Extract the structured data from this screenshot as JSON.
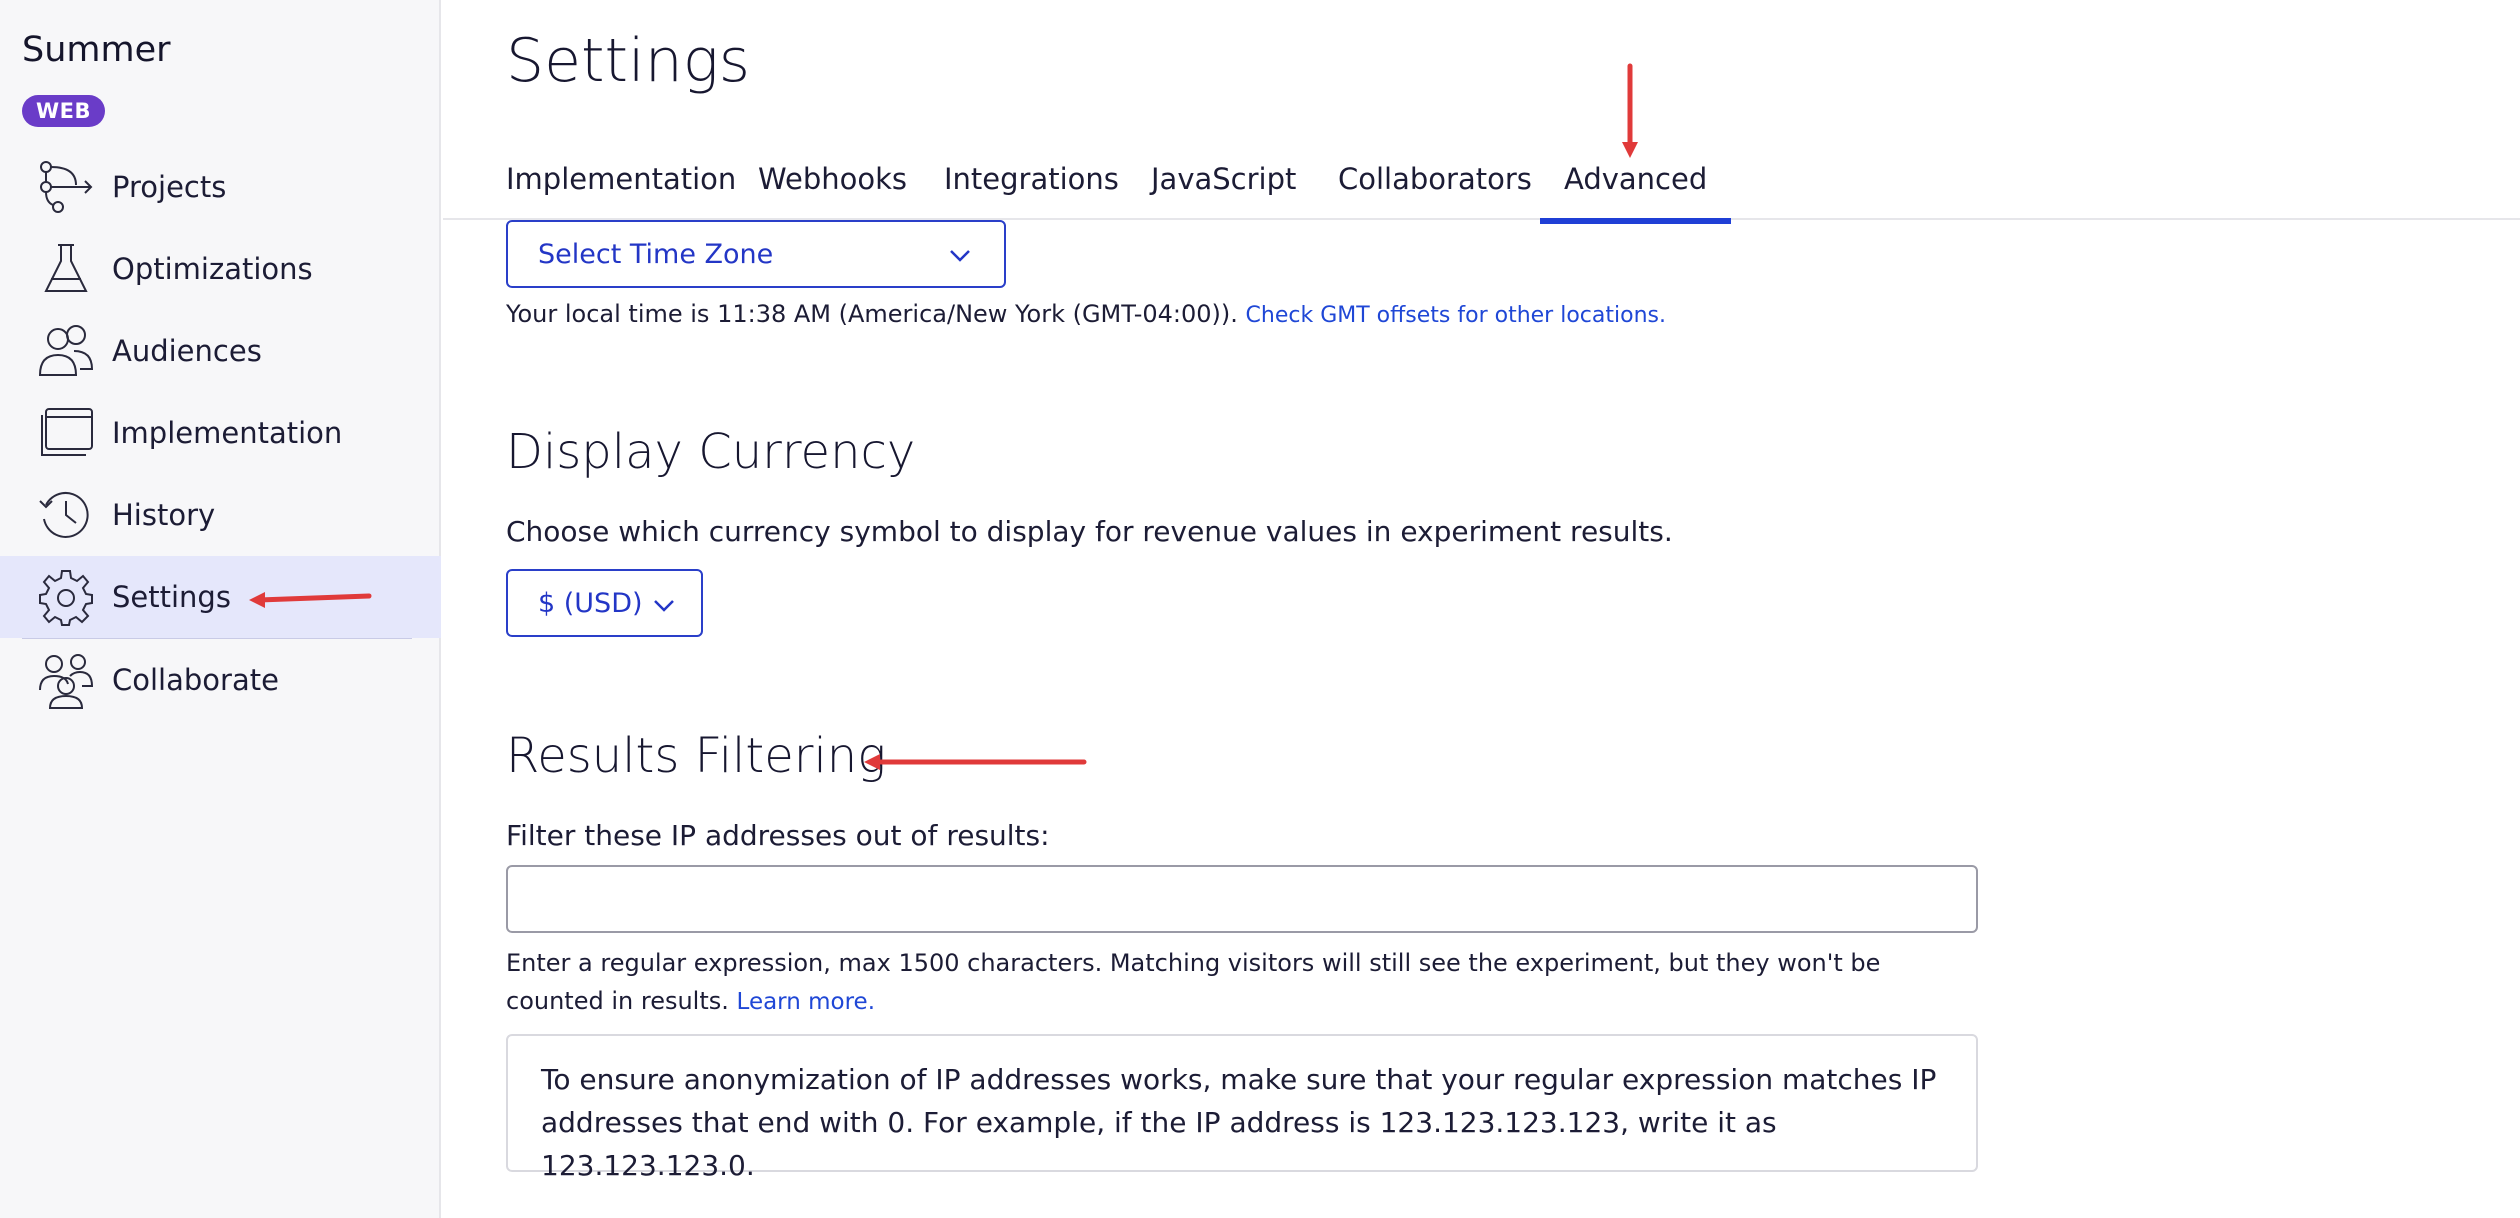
{
  "sidebar": {
    "brand": "Summer",
    "badge": "WEB",
    "items": [
      {
        "label": "Projects",
        "icon": "projects-icon"
      },
      {
        "label": "Optimizations",
        "icon": "flask-icon"
      },
      {
        "label": "Audiences",
        "icon": "audiences-icon"
      },
      {
        "label": "Implementation",
        "icon": "implementation-icon"
      },
      {
        "label": "History",
        "icon": "history-icon"
      },
      {
        "label": "Settings",
        "icon": "gear-icon",
        "active": true
      },
      {
        "label": "Collaborate",
        "icon": "collaborate-icon"
      }
    ]
  },
  "header": {
    "title": "Settings",
    "tabs": [
      "Implementation",
      "Webhooks",
      "Integrations",
      "JavaScript",
      "Collaborators",
      "Advanced"
    ],
    "active_tab": "Advanced"
  },
  "timezone": {
    "select_label": "Select Time Zone",
    "local_time_text": "Your local time is 11:38 AM (America/New York (GMT-04:00)).",
    "gmt_link": "Check GMT offsets for other locations."
  },
  "currency": {
    "heading": "Display Currency",
    "description": "Choose which currency symbol to display for revenue values in experiment results.",
    "selected": "$ (USD)"
  },
  "filtering": {
    "heading": "Results Filtering",
    "label": "Filter these IP addresses out of results:",
    "value": "",
    "help_text": "Enter a regular expression, max 1500 characters. Matching visitors will still see the experiment, but they won't be counted in results.",
    "learn_more": "Learn more.",
    "notice": "To ensure anonymization of IP addresses works, make sure that your regular expression matches IP addresses that end with 0. For example, if the IP address is 123.123.123.123, write it as 123.123.123.0."
  },
  "colors": {
    "accent": "#1f3fd6",
    "badge": "#6a3cc8",
    "annotation": "#e03a3a",
    "active_nav_bg": "#e5e7fb"
  }
}
